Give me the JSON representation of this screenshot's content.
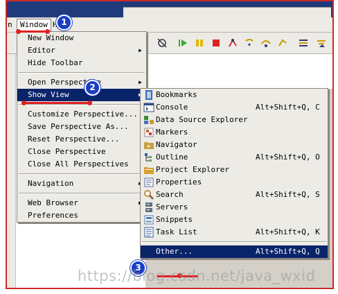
{
  "menubar": {
    "partial_left": "n",
    "window": "Window",
    "help_partial": "He"
  },
  "window_menu": {
    "items": [
      {
        "label": "New Window",
        "submenu": false
      },
      {
        "label": "Editor",
        "submenu": true
      },
      {
        "label": "Hide Toolbar",
        "submenu": false
      },
      {
        "separator": true
      },
      {
        "label": "Open Perspective",
        "submenu": true
      },
      {
        "label": "Show View",
        "submenu": true,
        "highlighted": true
      },
      {
        "separator": true
      },
      {
        "label": "Customize Perspective...",
        "submenu": false
      },
      {
        "label": "Save Perspective As...",
        "submenu": false
      },
      {
        "label": "Reset Perspective...",
        "submenu": false
      },
      {
        "label": "Close Perspective",
        "submenu": false
      },
      {
        "label": "Close All Perspectives",
        "submenu": false
      },
      {
        "separator": true
      },
      {
        "label": "Navigation",
        "submenu": true
      },
      {
        "separator": true
      },
      {
        "label": "Web Browser",
        "submenu": true
      },
      {
        "label": "Preferences",
        "submenu": false
      }
    ]
  },
  "show_view_menu": {
    "items": [
      {
        "label": "Bookmarks",
        "shortcut": "",
        "icon": "bookmarks-icon",
        "color": "#2d6bc8"
      },
      {
        "label": "Console",
        "shortcut": "Alt+Shift+Q, C",
        "icon": "console-icon",
        "color": "#2b4f8a"
      },
      {
        "label": "Data Source Explorer",
        "shortcut": "",
        "icon": "data-source-icon",
        "color": "#3a8a3a"
      },
      {
        "label": "Markers",
        "shortcut": "",
        "icon": "markers-icon",
        "color": "#d2691e"
      },
      {
        "label": "Navigator",
        "shortcut": "",
        "icon": "navigator-icon",
        "color": "#c8a040"
      },
      {
        "label": "Outline",
        "shortcut": "Alt+Shift+Q, O",
        "icon": "outline-icon",
        "color": "#3060b0"
      },
      {
        "label": "Project Explorer",
        "shortcut": "",
        "icon": "project-explorer-icon",
        "color": "#d4a030"
      },
      {
        "label": "Properties",
        "shortcut": "",
        "icon": "properties-icon",
        "color": "#5a6a9a"
      },
      {
        "label": "Search",
        "shortcut": "Alt+Shift+Q, S",
        "icon": "search-icon",
        "color": "#c09040"
      },
      {
        "label": "Servers",
        "shortcut": "",
        "icon": "servers-icon",
        "color": "#607080"
      },
      {
        "label": "Snippets",
        "shortcut": "",
        "icon": "snippets-icon",
        "color": "#4a7ab0"
      },
      {
        "label": "Task List",
        "shortcut": "Alt+Shift+Q, K",
        "icon": "task-list-icon",
        "color": "#3a5a9a"
      },
      {
        "separator": true
      },
      {
        "label": "Other...",
        "shortcut": "Alt+Shift+Q, Q",
        "icon": "",
        "highlighted": true
      }
    ]
  },
  "annotations": {
    "step1": "1",
    "step2": "2",
    "step3": "3"
  },
  "watermark": "https://blog.csdn.net/java_wxid",
  "colors": {
    "highlight": "#0a246a",
    "annotation_red": "#e02020",
    "badge_blue": "#1a3fc4",
    "frame_border": "#cc2a2a"
  }
}
